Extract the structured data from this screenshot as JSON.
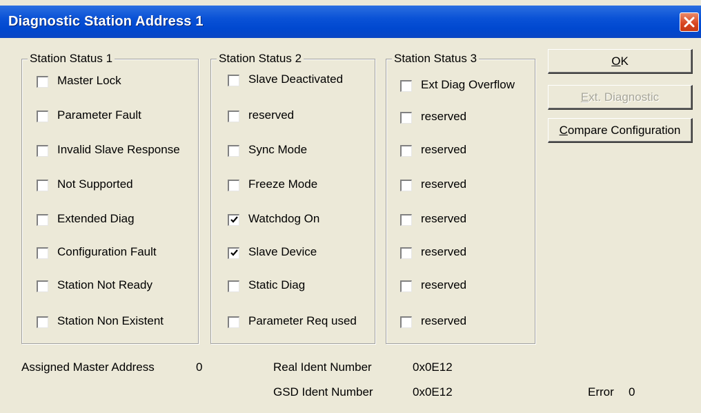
{
  "window": {
    "title": "Diagnostic Station Address 1"
  },
  "groups": [
    {
      "title": "Station Status 1",
      "items": [
        {
          "label": "Master Lock",
          "checked": false
        },
        {
          "label": "Parameter Fault",
          "checked": false
        },
        {
          "label": "Invalid Slave Response",
          "checked": false
        },
        {
          "label": "Not Supported",
          "checked": false
        },
        {
          "label": "Extended Diag",
          "checked": false
        },
        {
          "label": "Configuration Fault",
          "checked": false
        },
        {
          "label": "Station Not Ready",
          "checked": false
        },
        {
          "label": "Station Non Existent",
          "checked": false
        }
      ]
    },
    {
      "title": "Station Status 2",
      "items": [
        {
          "label": "Slave Deactivated",
          "checked": false
        },
        {
          "label": "reserved",
          "checked": false
        },
        {
          "label": "Sync Mode",
          "checked": false
        },
        {
          "label": "Freeze Mode",
          "checked": false
        },
        {
          "label": "Watchdog On",
          "checked": true
        },
        {
          "label": "Slave Device",
          "checked": true
        },
        {
          "label": "Static Diag",
          "checked": false
        },
        {
          "label": "Parameter Req used",
          "checked": false
        }
      ]
    },
    {
      "title": "Station Status 3",
      "items": [
        {
          "label": "Ext Diag Overflow",
          "checked": false
        },
        {
          "label": "reserved",
          "checked": false
        },
        {
          "label": "reserved",
          "checked": false
        },
        {
          "label": "reserved",
          "checked": false
        },
        {
          "label": "reserved",
          "checked": false
        },
        {
          "label": "reserved",
          "checked": false
        },
        {
          "label": "reserved",
          "checked": false
        },
        {
          "label": "reserved",
          "checked": false
        }
      ]
    }
  ],
  "buttons": {
    "ok": {
      "mnemonic": "O",
      "rest": "K"
    },
    "ext_diagnostic": {
      "mnemonic": "E",
      "rest": "xt. Diagnostic",
      "enabled": false
    },
    "compare": {
      "mnemonic": "C",
      "rest": "ompare Configuration"
    }
  },
  "info": {
    "assigned_master_label": "Assigned Master Address",
    "assigned_master_value": "0",
    "real_ident_label": "Real Ident Number",
    "real_ident_value": "0x0E12",
    "gsd_ident_label": "GSD Ident Number",
    "gsd_ident_value": "0x0E12",
    "error_label": "Error",
    "error_value": "0"
  },
  "colors": {
    "title_bar": "#0a52d6",
    "dialog_bg": "#ece9d8",
    "close_button": "#d8441f"
  }
}
